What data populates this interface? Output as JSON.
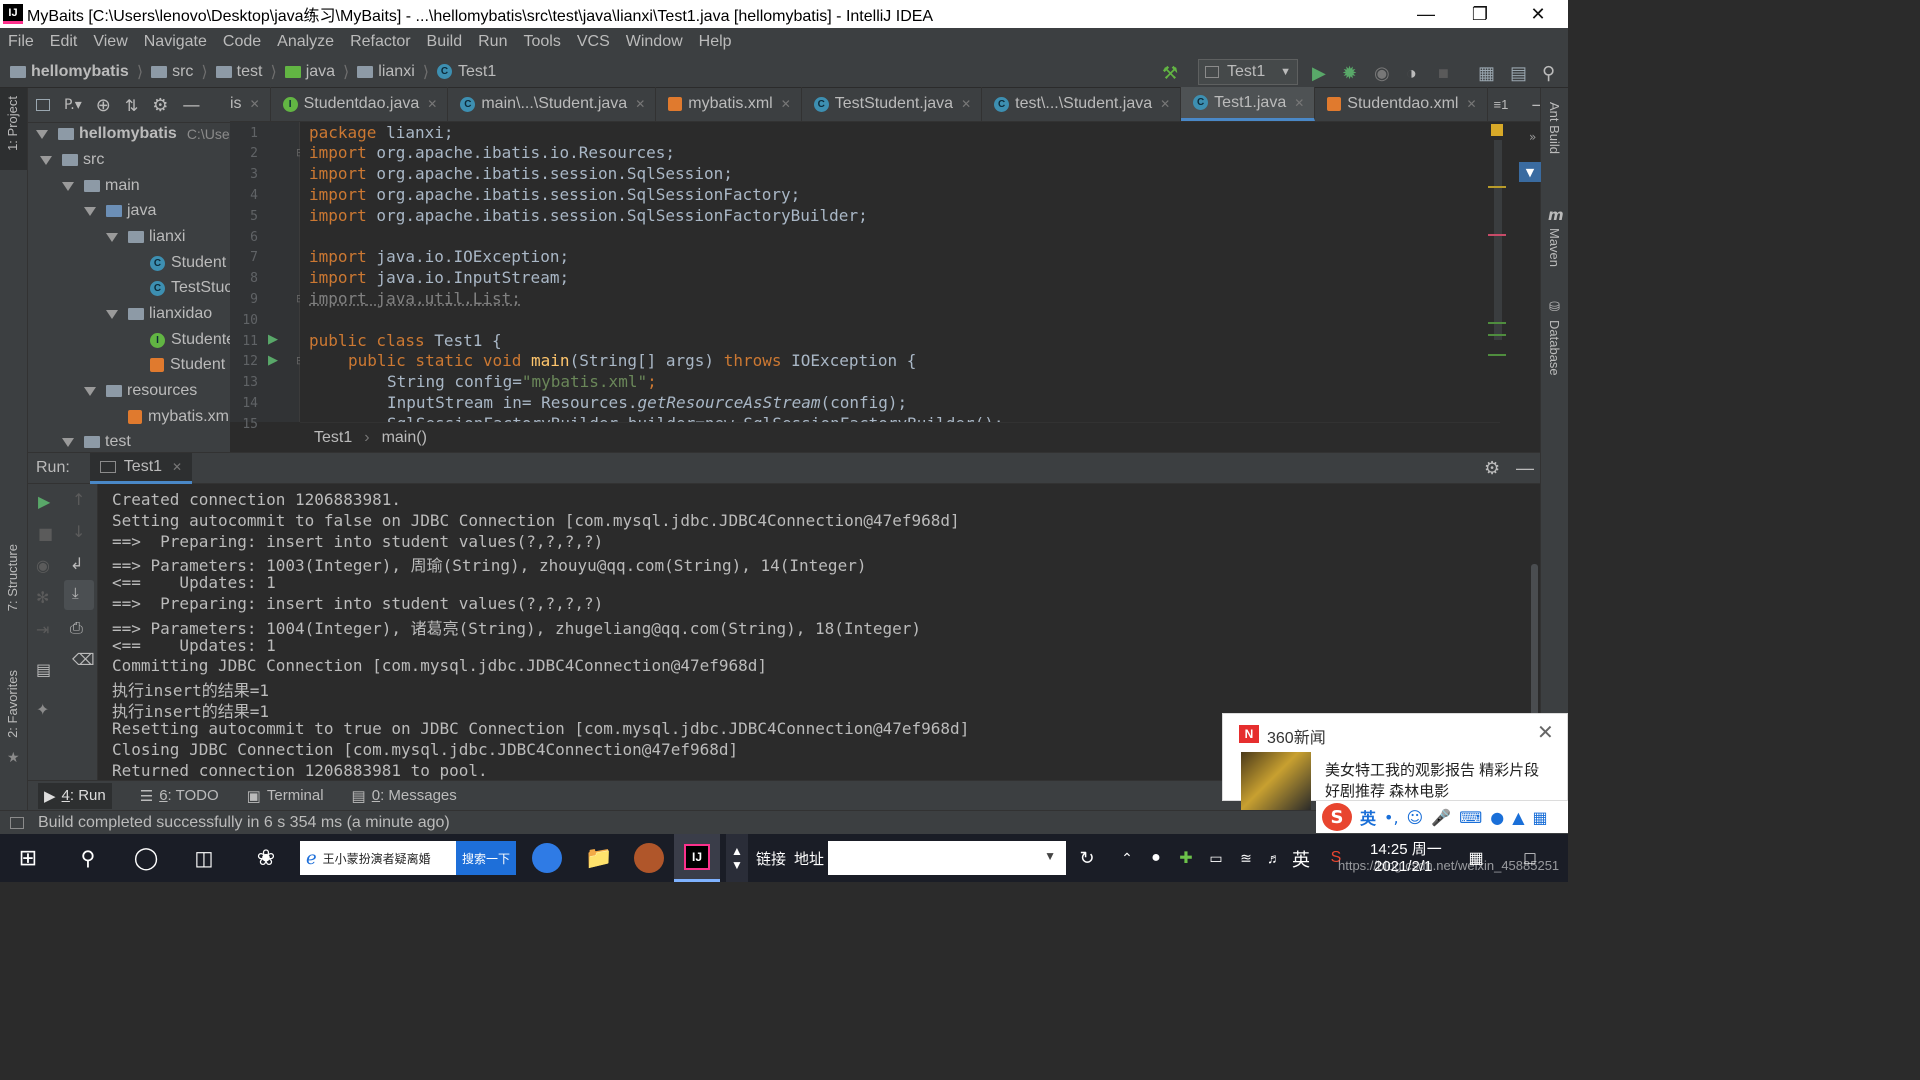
{
  "window": {
    "title": "MyBaits [C:\\Users\\lenovo\\Desktop\\java练习\\MyBaits] - ...\\hellomybatis\\src\\test\\java\\lianxi\\Test1.java [hellomybatis] - IntelliJ IDEA"
  },
  "menu": [
    "File",
    "Edit",
    "View",
    "Navigate",
    "Code",
    "Analyze",
    "Refactor",
    "Build",
    "Run",
    "Tools",
    "VCS",
    "Window",
    "Help"
  ],
  "nav": {
    "crumbs": [
      "hellomybatis",
      "src",
      "test",
      "java",
      "lianxi",
      "Test1"
    ],
    "run_config": "Test1"
  },
  "project": {
    "header": "P.▾",
    "root": "hellomybatis",
    "root_path": "C:\\Users\\l",
    "items": [
      "src",
      "main",
      "java",
      "lianxi",
      "Student",
      "TestStuc",
      "lianxidao",
      "Studente",
      "Student",
      "resources",
      "mybatis.xm",
      "test"
    ]
  },
  "tabs": [
    "is",
    "Studentdao.java",
    "main\\...\\Student.java",
    "mybatis.xml",
    "TestStudent.java",
    "test\\...\\Student.java",
    "Test1.java",
    "Studentdao.xml"
  ],
  "tabs_overflow": "≡1",
  "code": {
    "line_numbers": [
      "1",
      "2",
      "3",
      "4",
      "5",
      "6",
      "7",
      "8",
      "9",
      "10",
      "11",
      "12",
      "13",
      "14",
      "15"
    ],
    "l1_kw": "package",
    "l1_rest": " lianxi;",
    "imp": "import",
    "l2": " org.apache.ibatis.io.Resources;",
    "l3": " org.apache.ibatis.session.SqlSession;",
    "l4": " org.apache.ibatis.session.SqlSessionFactory;",
    "l5": " org.apache.ibatis.session.SqlSessionFactoryBuilder;",
    "l7": " java.io.IOException;",
    "l8": " java.io.InputStream;",
    "l9": " java.util.List;",
    "l11_kw": "public class",
    "l11_rest": " Test1 {",
    "l12_kw": "public static void",
    "l12_fn": "main",
    "l12_mid": "(String[] args) ",
    "l12_kw2": "throws",
    "l12_rest": " IOException {",
    "l13_a": "String config=",
    "l13_str": "\"mybatis.xml\"",
    "l13_b": ";",
    "l14_a": "InputStream in= Resources.",
    "l14_it": "getResourceAsStream",
    "l14_b": "(config);",
    "l15": "SqlSessionFactoryBuilder builder=new SqlSessionFactoryBuilder();"
  },
  "breadcrumb": {
    "class": "Test1",
    "method": "main()"
  },
  "run": {
    "label": "Run:",
    "tab": "Test1",
    "console": [
      "Created connection 1206883981.",
      "Setting autocommit to false on JDBC Connection [com.mysql.jdbc.JDBC4Connection@47ef968d]",
      "==>  Preparing: insert into student values(?,?,?,?)",
      "==> Parameters: 1003(Integer), 周瑜(String), zhouyu@qq.com(String), 14(Integer)",
      "<==    Updates: 1",
      "==>  Preparing: insert into student values(?,?,?,?)",
      "==> Parameters: 1004(Integer), 诸葛亮(String), zhugeliang@qq.com(String), 18(Integer)",
      "<==    Updates: 1",
      "Committing JDBC Connection [com.mysql.jdbc.JDBC4Connection@47ef968d]",
      "执行insert的结果=1",
      "执行insert的结果=1",
      "Resetting autocommit to true on JDBC Connection [com.mysql.jdbc.JDBC4Connection@47ef968d]",
      "Closing JDBC Connection [com.mysql.jdbc.JDBC4Connection@47ef968d]",
      "Returned connection 1206883981 to pool."
    ]
  },
  "bottom_tabs": {
    "run_num": "4",
    "run": ": Run",
    "todo_num": "6",
    "todo": ": TODO",
    "terminal": "Terminal",
    "messages_num": "0",
    "messages": ": Messages"
  },
  "status": "Build completed successfully in 6 s 354 ms (a minute ago)",
  "left_strip": {
    "project": "1: Project",
    "structure": "7: Structure",
    "favorites": "2: Favorites"
  },
  "right_strip": {
    "ant": "Ant Build",
    "maven": "Maven",
    "database": "Database"
  },
  "notification": {
    "source": "360新闻",
    "text": "美女特工我的观影报告 精彩片段 好剧推荐  森林电影"
  },
  "ime": {
    "lang": "英",
    "extra": "•,"
  },
  "taskbar": {
    "search_text": "王小蒙扮演者疑离婚",
    "search_button": "搜索一下",
    "link": "链接",
    "address": "地址",
    "lang": "英",
    "time": "14:25 周一",
    "date": "2021/2/1",
    "watermark": "https://blog.csdn.net/weixin_45885251"
  }
}
